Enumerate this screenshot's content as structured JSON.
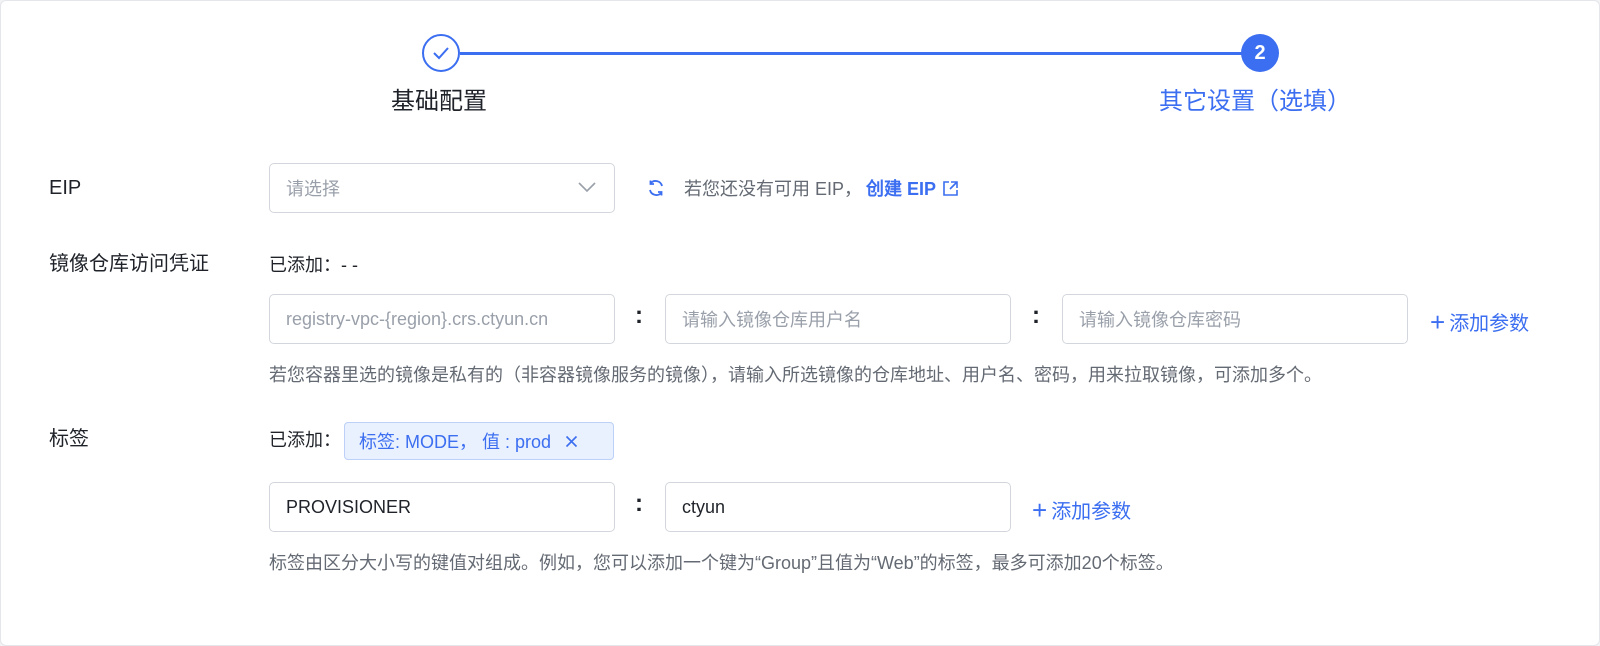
{
  "steps": [
    {
      "label": "基础配置",
      "state": "done"
    },
    {
      "number": "2",
      "label": "其它设置（选填）",
      "state": "active"
    }
  ],
  "eip": {
    "label": "EIP",
    "select_placeholder": "请选择",
    "tip_text": "若您还没有可用 EIP，",
    "create_link": "创建 EIP"
  },
  "registry": {
    "label": "镜像仓库访问凭证",
    "added_text": "已添加：- -",
    "address_placeholder": "registry-vpc-{region}.crs.ctyun.cn",
    "username_placeholder": "请输入镜像仓库用户名",
    "password_placeholder": "请输入镜像仓库密码",
    "colon": ":",
    "add_param": "添加参数",
    "help": "若您容器里选的镜像是私有的（非容器镜像服务的镜像），请输入所选镜像的仓库地址、用户名、密码，用来拉取镜像，可添加多个。"
  },
  "tags": {
    "label": "标签",
    "added_prefix": "已添加：",
    "chip_text": "标签: MODE，  值 : prod",
    "key_value": "PROVISIONER",
    "value_value": "ctyun",
    "colon": ":",
    "add_param": "添加参数",
    "help": "标签由区分大小写的键值对组成。例如，您可以添加一个键为“Group”且值为“Web”的标签，最多可添加20个标签。"
  },
  "colors": {
    "primary": "#3b6ef0",
    "text": "#1f2329",
    "muted": "#646a73",
    "border": "#d3d6dc"
  }
}
